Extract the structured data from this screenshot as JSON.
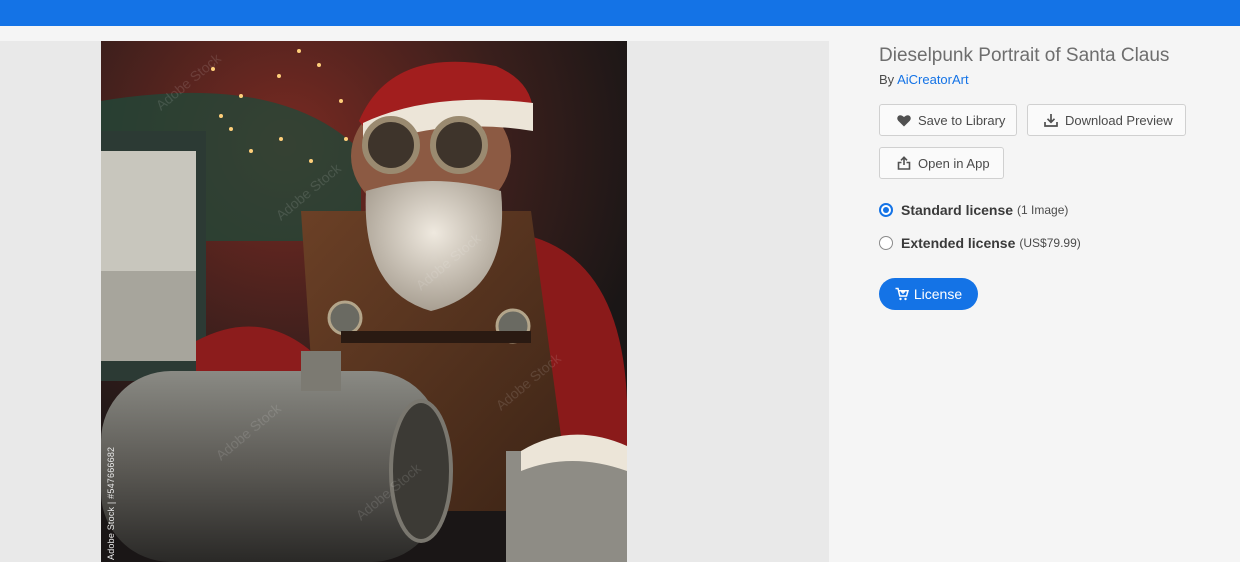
{
  "asset": {
    "title": "Dieselpunk Portrait of Santa Claus",
    "by_prefix": "By",
    "author": "AiCreatorArt",
    "watermark_id": "Adobe Stock | #547666682",
    "watermark_tile": "Adobe Stock"
  },
  "actions": {
    "save_label": "Save to Library",
    "download_label": "Download Preview",
    "open_label": "Open in App"
  },
  "licenses": [
    {
      "name": "Standard license",
      "detail": "(1 Image)",
      "selected": true
    },
    {
      "name": "Extended license",
      "detail": "(US$79.99)",
      "selected": false
    }
  ],
  "license_button": {
    "label": "License"
  },
  "colors": {
    "brand_blue": "#1473e6"
  },
  "icons": {
    "save": "heart-icon",
    "download": "download-icon",
    "open": "share-icon",
    "license": "cart-icon"
  }
}
